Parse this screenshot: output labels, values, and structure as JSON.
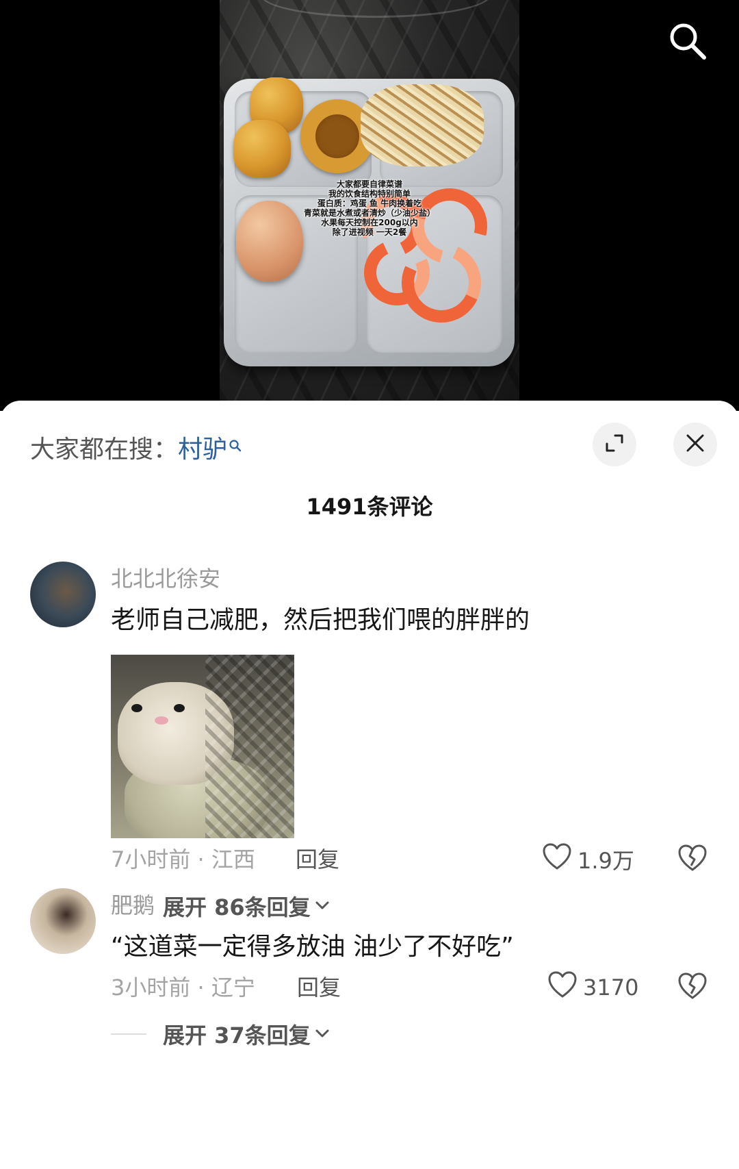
{
  "video": {
    "caption_lines": [
      "大家都要自律菜谱",
      "我的饮食结构特别简单",
      "蛋白质：鸡蛋 鱼 牛肉换着吃",
      "青菜就是水煮或者清炒（少油少盐）",
      "水果每天控制在200g以内",
      "除了进视频 一天2餐"
    ]
  },
  "panel": {
    "trending_prefix": "大家都在搜：",
    "trending_keyword": "村驴",
    "comment_count": "1491条评论"
  },
  "comments": [
    {
      "username": "北北北徐安",
      "text": "老师自己减肥，然后把我们喂的胖胖的",
      "has_image": true,
      "meta": "7小时前 · 江西",
      "reply_label": "回复",
      "likes": "1.9万",
      "expand_label": "展开 86条回复"
    },
    {
      "username": "肥鹅",
      "text": "“这道菜一定得多放油 油少了不好吃”",
      "has_image": false,
      "meta": "3小时前 · 辽宁",
      "reply_label": "回复",
      "likes": "3170",
      "expand_label": "展开 37条回复"
    }
  ],
  "icons": {
    "search": "search-icon",
    "expand": "expand-icon",
    "close": "close-icon",
    "like": "heart-outline-icon",
    "dislike": "broken-heart-icon",
    "chevron": "chevron-down-icon"
  }
}
